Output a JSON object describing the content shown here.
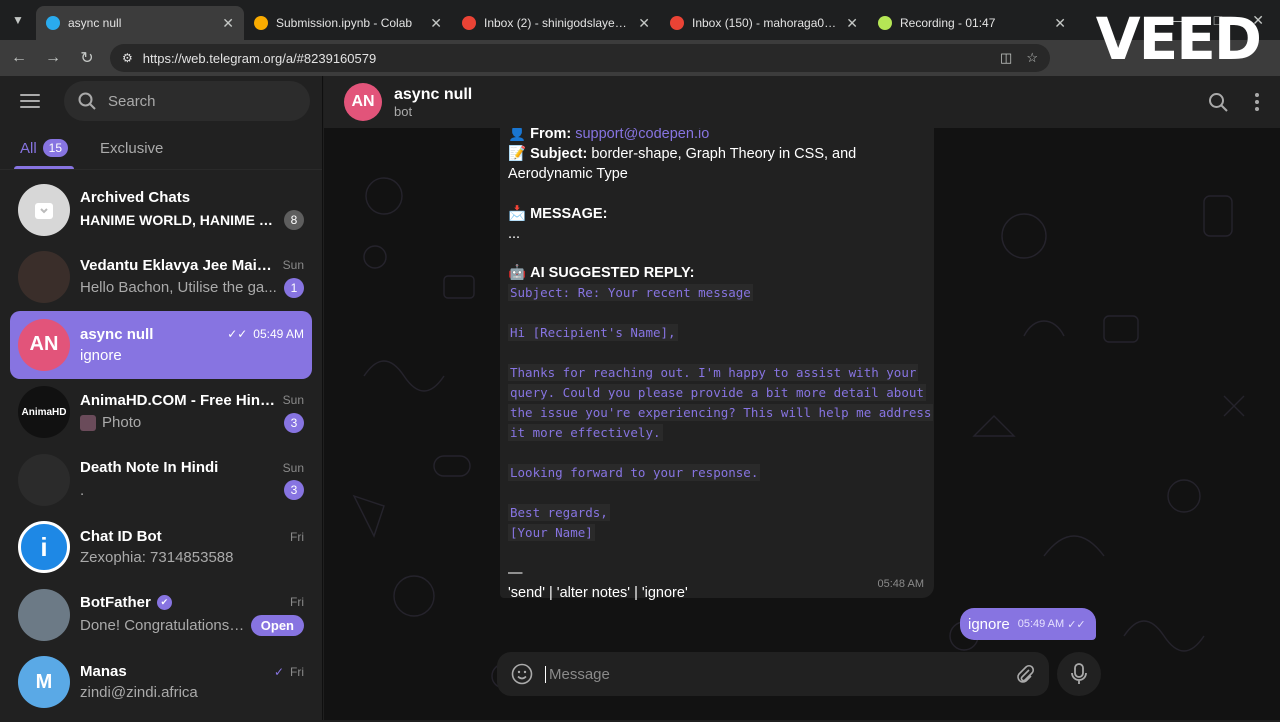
{
  "browser": {
    "tabs": [
      {
        "title": "async null",
        "fav": "telegram-icon",
        "color": "#2aabee",
        "active": true
      },
      {
        "title": "Submission.ipynb - Colab",
        "fav": "colab-icon",
        "color": "#f9ab00",
        "active": false
      },
      {
        "title": "Inbox (2) - shinigodslayer@gm",
        "fav": "gmail-icon",
        "color": "#ea4335",
        "active": false
      },
      {
        "title": "Inbox (150) - mahoraga0087@",
        "fav": "gmail-icon",
        "color": "#ea4335",
        "active": false
      },
      {
        "title": "Recording - 01:47",
        "fav": "veed-icon",
        "color": "#b5e655",
        "active": false
      }
    ],
    "url": "https://web.telegram.org/a/#8239160579",
    "watermark": "VEED"
  },
  "sidebar": {
    "search_placeholder": "Search",
    "folders": [
      {
        "label": "All",
        "badge": "15"
      },
      {
        "label": "Exclusive",
        "badge": ""
      }
    ],
    "chats": [
      {
        "name": "Archived Chats",
        "message": "HANIME WORLD, HANIME W...",
        "time": "",
        "badge": "8",
        "avatar": "",
        "avatar_color": "#d7d7d7",
        "muted": true,
        "bold_msg": true
      },
      {
        "name": "Vedantu Eklavya Jee Main T...",
        "message": "Hello Bachon, Utilise the ga...",
        "time": "Sun",
        "badge": "1",
        "avatar": "",
        "avatar_color": "#3a2e2a"
      },
      {
        "name": "async null",
        "message": "ignore",
        "time": "05:49 AM",
        "badge": "",
        "avatar": "AN",
        "avatar_color": "#e2547a",
        "active": true,
        "read": "✓✓"
      },
      {
        "name": "AnimaHD.COM - Free Hindi ...",
        "message": "Photo",
        "time": "Sun",
        "badge": "3",
        "avatar": "AnimaHD",
        "avatar_color": "#111111",
        "photo": true
      },
      {
        "name": "Death Note In Hindi",
        "message": ".",
        "time": "Sun",
        "badge": "3",
        "avatar": "",
        "avatar_color": "#2b2b2b"
      },
      {
        "name": "Chat ID Bot",
        "message": "Zexophia: 7314853588",
        "time": "Fri",
        "badge": "",
        "avatar": "i",
        "avatar_color": "#1e88e5"
      },
      {
        "name": "BotFather",
        "message": "Done! Congratulations o...",
        "time": "Fri",
        "badge": "",
        "avatar": "",
        "avatar_color": "#6c7a86",
        "verified": true,
        "pill": "Open"
      },
      {
        "name": "Manas",
        "message": "zindi@zindi.africa",
        "time": "Fri",
        "badge": "",
        "avatar": "M",
        "avatar_color": "#5aa9e6",
        "read": "✓"
      }
    ]
  },
  "chat": {
    "name": "async null",
    "status": "bot",
    "avatar": "AN",
    "incoming": {
      "from_label": "From:",
      "from_value": "support@codepen.io",
      "subject_label": "Subject:",
      "subject_value": "border-shape, Graph Theory in CSS, and",
      "subject_cont": "Aerodynamic Type",
      "message_label": "MESSAGE:",
      "message_value": "...",
      "ai_label": "AI SUGGESTED REPLY:",
      "reply_lines": [
        "Subject: Re: Your recent message",
        "",
        "Hi [Recipient's Name],",
        "",
        "Thanks for reaching out. I'm happy to assist with your",
        "query. Could you please provide a bit more detail about",
        "the issue you're experiencing? This will help me address",
        "it more effectively.",
        "",
        "Looking forward to your response.",
        "",
        "Best regards,",
        "[Your Name]"
      ],
      "separator": "—",
      "options": "'send' | 'alter notes' | 'ignore'",
      "time": "05:48 AM"
    },
    "outgoing": {
      "text": "ignore",
      "time": "05:49 AM"
    },
    "composer_placeholder": "Message"
  }
}
